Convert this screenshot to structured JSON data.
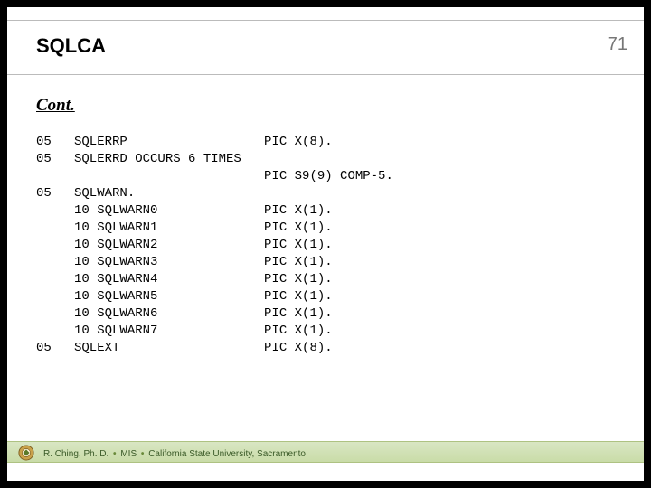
{
  "slide": {
    "title": "SQLCA",
    "page_number": "71",
    "subtitle": "Cont."
  },
  "code": {
    "l01": "05   SQLERRP                  PIC X(8).",
    "l02": "05   SQLERRD OCCURS 6 TIMES",
    "l03": "                              PIC S9(9) COMP-5.",
    "l04": "05   SQLWARN.",
    "l05": "     10 SQLWARN0              PIC X(1).",
    "l06": "     10 SQLWARN1              PIC X(1).",
    "l07": "     10 SQLWARN2              PIC X(1).",
    "l08": "     10 SQLWARN3              PIC X(1).",
    "l09": "     10 SQLWARN4              PIC X(1).",
    "l10": "     10 SQLWARN5              PIC X(1).",
    "l11": "     10 SQLWARN6              PIC X(1).",
    "l12": "     10 SQLWARN7              PIC X(1).",
    "l13": "05   SQLEXT                   PIC X(8)."
  },
  "footer": {
    "author": "R. Ching, Ph. D.",
    "dept": "MIS",
    "org": "California State University, Sacramento",
    "bullet": "•"
  }
}
